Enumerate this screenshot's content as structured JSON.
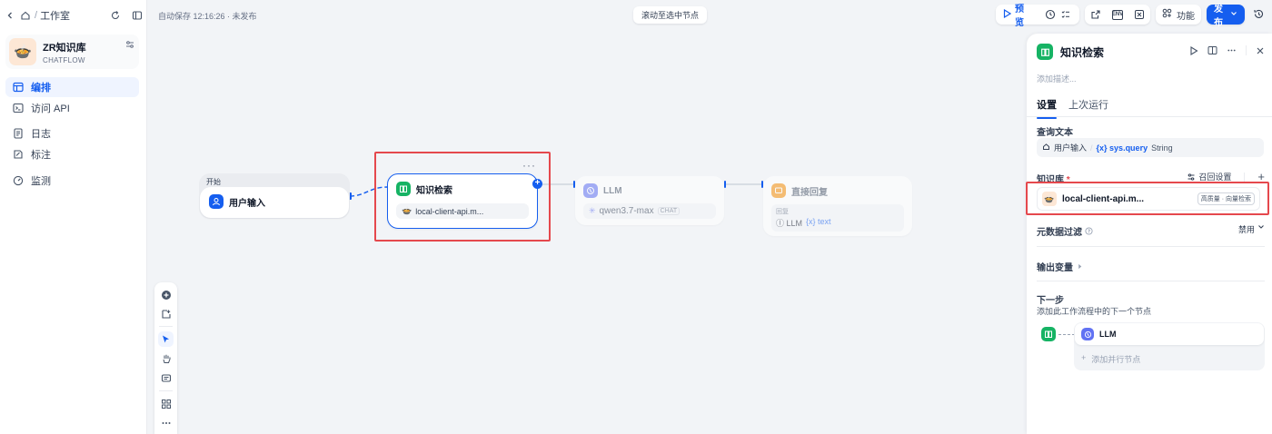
{
  "sidebar": {
    "breadcrumb": "工作室",
    "app": {
      "name": "ZR知识库",
      "type": "CHATFLOW"
    },
    "nav": [
      {
        "label": "编排",
        "active": true
      },
      {
        "label": "访问 API",
        "active": false
      },
      {
        "label": "日志",
        "active": false
      },
      {
        "label": "标注",
        "active": false
      },
      {
        "label": "监测",
        "active": false
      }
    ]
  },
  "canvas": {
    "autosave": "自动保存 12:16:26 · 未发布",
    "scroll_button": "滚动至选中节点",
    "nodes": {
      "start": {
        "group": "开始",
        "title": "用户输入"
      },
      "knowledge": {
        "title": "知识检索",
        "dataset": "local-client-api.m...",
        "more": "···"
      },
      "llm": {
        "title": "LLM",
        "model": "qwen3.7-max",
        "mode": "CHAT"
      },
      "answer": {
        "title": "直接回复",
        "section": "回复",
        "ref_node": "LLM",
        "ref_var": "text"
      }
    }
  },
  "toolbar": {
    "preview": "预览",
    "features": "功能",
    "publish": "发布"
  },
  "panel": {
    "title": "知识检索",
    "desc_placeholder": "添加描述...",
    "tabs": [
      "设置",
      "上次运行"
    ],
    "query_label": "查询文本",
    "query": {
      "node": "用户输入",
      "var": "sys.query",
      "type": "String"
    },
    "kb_label": "知识库",
    "kb_required": "*",
    "recall_settings": "召回设置",
    "kb_item": {
      "name": "local-client-api.m...",
      "badge": "高质量 · 向量检索"
    },
    "metadata_label": "元数据过滤",
    "metadata_value": "禁用",
    "output_label": "输出变量",
    "next_label": "下一步",
    "next_desc": "添加此工作流程中的下一个节点",
    "next_node": "LLM",
    "add_parallel": "添加并行节点"
  },
  "colors": {
    "accent": "#155eef",
    "knowledge_green": "#16b364",
    "llm_purple": "#6172f3",
    "answer_orange": "#f79009",
    "selection_red": "#e5484d"
  }
}
